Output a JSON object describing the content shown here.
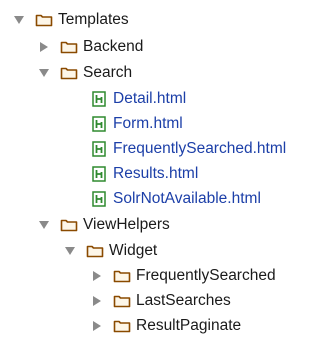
{
  "tree": {
    "templates": {
      "label": "Templates"
    },
    "backend": {
      "label": "Backend"
    },
    "search": {
      "label": "Search",
      "files": [
        "Detail.html",
        "Form.html",
        "FrequentlySearched.html",
        "Results.html",
        "SolrNotAvailable.html"
      ]
    },
    "viewhelpers": {
      "label": "ViewHelpers"
    },
    "widget": {
      "label": "Widget",
      "children": [
        "FrequentlySearched",
        "LastSearches",
        "ResultPaginate"
      ]
    }
  },
  "colors": {
    "folder_stroke": "#8a4a00",
    "folder_fill": "#fdf6e8",
    "file_green": "#2f8a2f",
    "file_label": "#1c3fa8",
    "arrow": "#8a8a8a"
  },
  "icons": {
    "expanded": "triangle-down-icon",
    "collapsed": "triangle-right-icon",
    "folder": "folder-icon",
    "file": "html-file-icon"
  }
}
